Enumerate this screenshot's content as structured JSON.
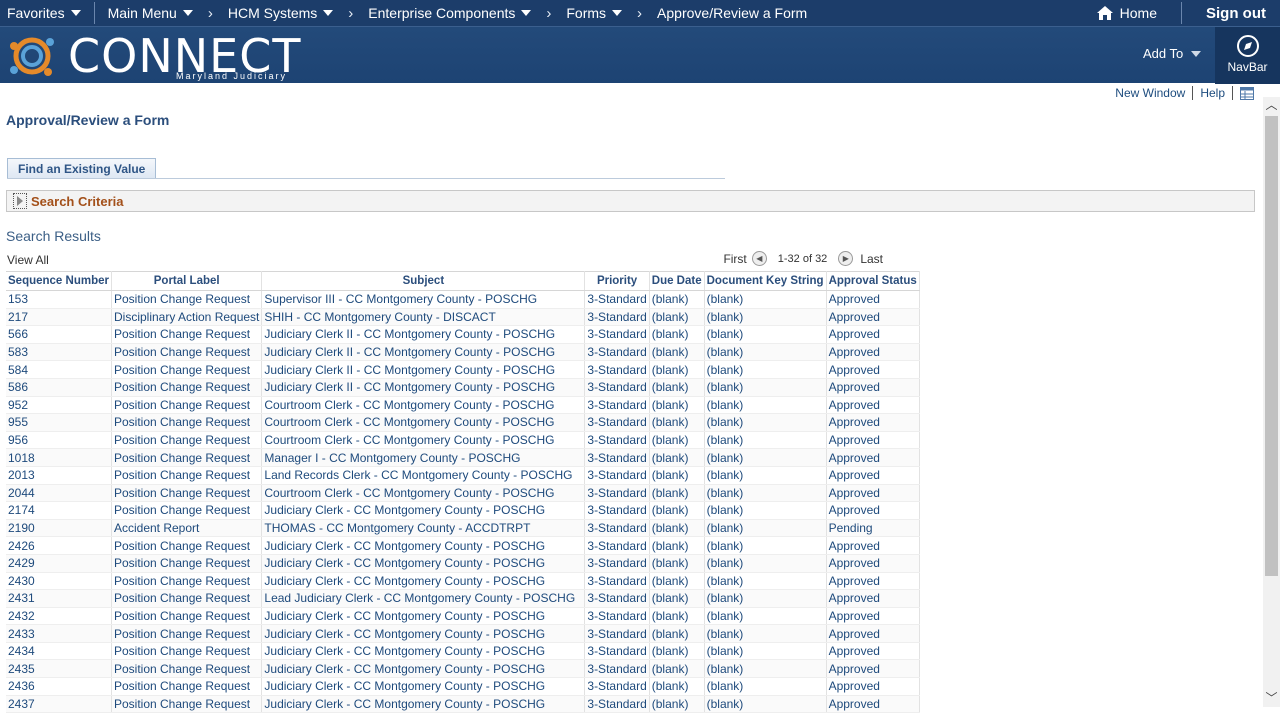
{
  "topnav": {
    "favorites": "Favorites",
    "main_menu": "Main Menu",
    "breadcrumbs": [
      "HCM Systems",
      "Enterprise Components",
      "Forms",
      "Approve/Review a Form"
    ],
    "home": "Home",
    "signout": "Sign out"
  },
  "banner": {
    "logo_text": "CONNECT",
    "logo_subtitle": "Maryland Judiciary",
    "add_to": "Add To",
    "navbar": "NavBar"
  },
  "page_links": {
    "new_window": "New Window",
    "help": "Help"
  },
  "page_title": "Approval/Review a Form",
  "tab_label": "Find an Existing Value",
  "search_criteria": "Search Criteria",
  "results": {
    "title": "Search Results",
    "view_all": "View All",
    "first": "First",
    "range": "1-32 of 32",
    "last": "Last",
    "columns": [
      "Sequence Number",
      "Portal Label",
      "Subject",
      "Priority",
      "Due Date",
      "Document Key String",
      "Approval Status"
    ],
    "rows": [
      [
        "153",
        "Position Change Request",
        "Supervisor III - CC Montgomery County - POSCHG",
        "3-Standard",
        "(blank)",
        "(blank)",
        "Approved"
      ],
      [
        "217",
        "Disciplinary Action Request",
        "SHIH - CC Montgomery County - DISCACT",
        "3-Standard",
        "(blank)",
        "(blank)",
        "Approved"
      ],
      [
        "566",
        "Position Change Request",
        "Judiciary Clerk II - CC Montgomery County - POSCHG",
        "3-Standard",
        "(blank)",
        "(blank)",
        "Approved"
      ],
      [
        "583",
        "Position Change Request",
        "Judiciary Clerk II - CC Montgomery County - POSCHG",
        "3-Standard",
        "(blank)",
        "(blank)",
        "Approved"
      ],
      [
        "584",
        "Position Change Request",
        "Judiciary Clerk II - CC Montgomery County - POSCHG",
        "3-Standard",
        "(blank)",
        "(blank)",
        "Approved"
      ],
      [
        "586",
        "Position Change Request",
        "Judiciary Clerk II - CC Montgomery County - POSCHG",
        "3-Standard",
        "(blank)",
        "(blank)",
        "Approved"
      ],
      [
        "952",
        "Position Change Request",
        "Courtroom Clerk - CC Montgomery County - POSCHG",
        "3-Standard",
        "(blank)",
        "(blank)",
        "Approved"
      ],
      [
        "955",
        "Position Change Request",
        "Courtroom Clerk - CC Montgomery County - POSCHG",
        "3-Standard",
        "(blank)",
        "(blank)",
        "Approved"
      ],
      [
        "956",
        "Position Change Request",
        "Courtroom Clerk - CC Montgomery County - POSCHG",
        "3-Standard",
        "(blank)",
        "(blank)",
        "Approved"
      ],
      [
        "1018",
        "Position Change Request",
        "Manager I - CC Montgomery County - POSCHG",
        "3-Standard",
        "(blank)",
        "(blank)",
        "Approved"
      ],
      [
        "2013",
        "Position Change Request",
        "Land Records Clerk - CC Montgomery County - POSCHG",
        "3-Standard",
        "(blank)",
        "(blank)",
        "Approved"
      ],
      [
        "2044",
        "Position Change Request",
        "Courtroom Clerk - CC Montgomery County - POSCHG",
        "3-Standard",
        "(blank)",
        "(blank)",
        "Approved"
      ],
      [
        "2174",
        "Position Change Request",
        "Judiciary Clerk - CC Montgomery County - POSCHG",
        "3-Standard",
        "(blank)",
        "(blank)",
        "Approved"
      ],
      [
        "2190",
        "Accident Report",
        "THOMAS - CC Montgomery County - ACCDTRPT",
        "3-Standard",
        "(blank)",
        "(blank)",
        "Pending"
      ],
      [
        "2426",
        "Position Change Request",
        "Judiciary Clerk - CC Montgomery County - POSCHG",
        "3-Standard",
        "(blank)",
        "(blank)",
        "Approved"
      ],
      [
        "2429",
        "Position Change Request",
        "Judiciary Clerk - CC Montgomery County - POSCHG",
        "3-Standard",
        "(blank)",
        "(blank)",
        "Approved"
      ],
      [
        "2430",
        "Position Change Request",
        "Judiciary Clerk - CC Montgomery County - POSCHG",
        "3-Standard",
        "(blank)",
        "(blank)",
        "Approved"
      ],
      [
        "2431",
        "Position Change Request",
        "Lead Judiciary Clerk - CC Montgomery County - POSCHG",
        "3-Standard",
        "(blank)",
        "(blank)",
        "Approved"
      ],
      [
        "2432",
        "Position Change Request",
        "Judiciary Clerk - CC Montgomery County - POSCHG",
        "3-Standard",
        "(blank)",
        "(blank)",
        "Approved"
      ],
      [
        "2433",
        "Position Change Request",
        "Judiciary Clerk - CC Montgomery County - POSCHG",
        "3-Standard",
        "(blank)",
        "(blank)",
        "Approved"
      ],
      [
        "2434",
        "Position Change Request",
        "Judiciary Clerk - CC Montgomery County - POSCHG",
        "3-Standard",
        "(blank)",
        "(blank)",
        "Approved"
      ],
      [
        "2435",
        "Position Change Request",
        "Judiciary Clerk - CC Montgomery County - POSCHG",
        "3-Standard",
        "(blank)",
        "(blank)",
        "Approved"
      ],
      [
        "2436",
        "Position Change Request",
        "Judiciary Clerk - CC Montgomery County - POSCHG",
        "3-Standard",
        "(blank)",
        "(blank)",
        "Approved"
      ],
      [
        "2437",
        "Position Change Request",
        "Judiciary Clerk - CC Montgomery County - POSCHG",
        "3-Standard",
        "(blank)",
        "(blank)",
        "Approved"
      ]
    ]
  },
  "colors": {
    "nav_bg": "#1c3d6a",
    "banner_bg": "#1d4373",
    "link": "#1e4a7c",
    "criteria_text": "#a3501a"
  }
}
